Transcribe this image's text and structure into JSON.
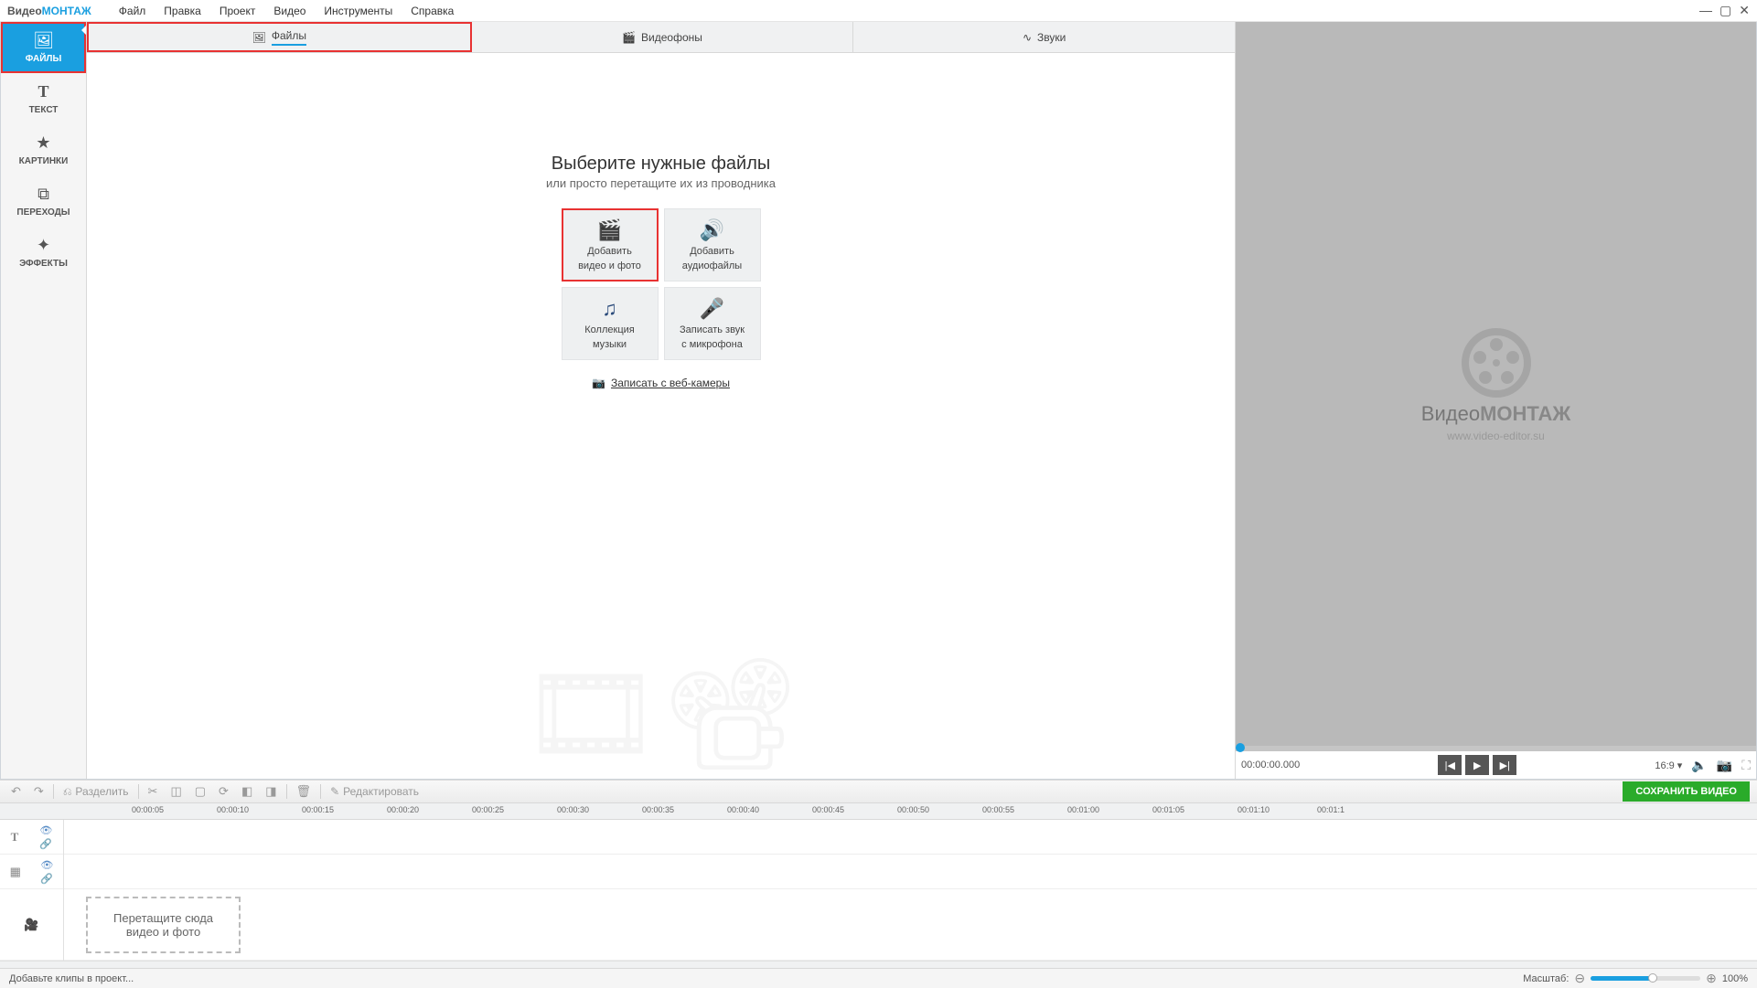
{
  "app": {
    "logo1": "Видео",
    "logo2": "МОНТАЖ"
  },
  "menu": [
    "Файл",
    "Правка",
    "Проект",
    "Видео",
    "Инструменты",
    "Справка"
  ],
  "sidebar": [
    {
      "label": "ФАЙЛЫ",
      "icon": "🖼"
    },
    {
      "label": "ТЕКСТ",
      "icon": "T"
    },
    {
      "label": "КАРТИНКИ",
      "icon": "★"
    },
    {
      "label": "ПЕРЕХОДЫ",
      "icon": "⧉"
    },
    {
      "label": "ЭФФЕКТЫ",
      "icon": "✦"
    }
  ],
  "tabs": [
    {
      "label": "Файлы"
    },
    {
      "label": "Видеофоны"
    },
    {
      "label": "Звуки"
    }
  ],
  "center": {
    "title": "Выберите нужные файлы",
    "subtitle": "или просто перетащите их из проводника",
    "btns": [
      {
        "l1": "Добавить",
        "l2": "видео и фото"
      },
      {
        "l1": "Добавить",
        "l2": "аудиофайлы"
      },
      {
        "l1": "Коллекция",
        "l2": "музыки"
      },
      {
        "l1": "Записать звук",
        "l2": "с микрофона"
      }
    ],
    "weblink": "Записать с веб-камеры"
  },
  "preview": {
    "brand1": "Видео",
    "brand2": "МОНТАЖ",
    "url": "www.video-editor.su",
    "timecode": "00:00:00.000",
    "ratio": "16:9 ▾"
  },
  "toolbar": {
    "split": "Разделить",
    "edit": "Редактировать",
    "save": "СОХРАНИТЬ ВИДЕО"
  },
  "ruler": [
    "00:00:05",
    "00:00:10",
    "00:00:15",
    "00:00:20",
    "00:00:25",
    "00:00:30",
    "00:00:35",
    "00:00:40",
    "00:00:45",
    "00:00:50",
    "00:00:55",
    "00:01:00",
    "00:01:05",
    "00:01:10",
    "00:01:1"
  ],
  "dropzone": {
    "l1": "Перетащите сюда",
    "l2": "видео и фото"
  },
  "status": {
    "hint": "Добавьте клипы в проект...",
    "zoomlabel": "Масштаб:",
    "zoomval": "100%"
  }
}
